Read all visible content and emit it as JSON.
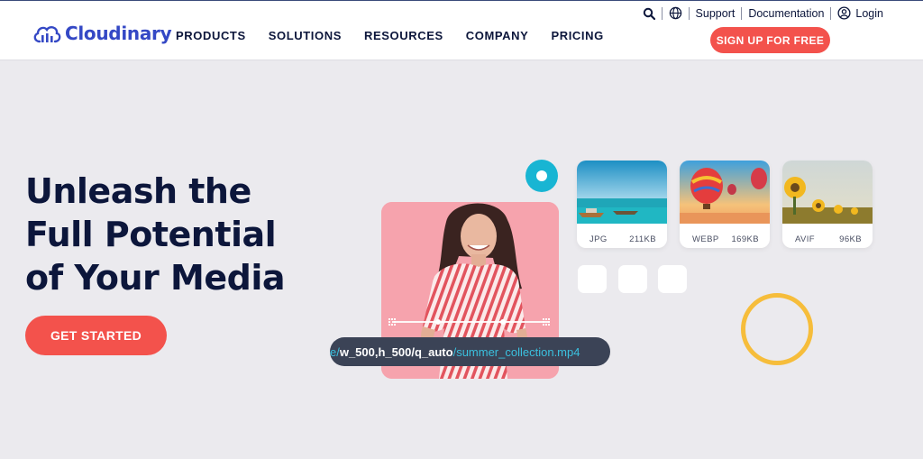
{
  "brand": {
    "name": "Cloudinary",
    "color": "#3448c5"
  },
  "nav": {
    "items": [
      "PRODUCTS",
      "SOLUTIONS",
      "RESOURCES",
      "COMPANY",
      "PRICING"
    ]
  },
  "utility": {
    "support": "Support",
    "documentation": "Documentation",
    "login": "Login",
    "signup": "SIGN UP FOR FREE"
  },
  "hero": {
    "title_lines": [
      "Unleash the",
      "Full Potential",
      "of Your Media"
    ],
    "cta": "GET STARTED"
  },
  "media_url": {
    "prefix": "e/",
    "transform": "w_500,h_500/q_auto",
    "suffix": "/summer_collection.mp4"
  },
  "formats": [
    {
      "format": "JPG",
      "size": "211KB",
      "image": "boat-on-sea"
    },
    {
      "format": "WEBP",
      "size": "169KB",
      "image": "hot-air-balloons"
    },
    {
      "format": "AVIF",
      "size": "96KB",
      "image": "sunflowers"
    }
  ],
  "colors": {
    "accent": "#f3524c",
    "navy": "#0c163b",
    "teal": "#18b5d3",
    "yellow": "#f6bd3b",
    "background": "#ebeaee"
  }
}
